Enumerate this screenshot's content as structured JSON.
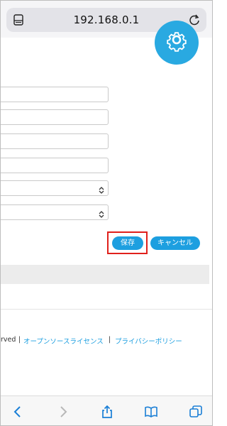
{
  "browser": {
    "url": "192.168.0.1",
    "menu_icon": "page-menu-icon",
    "reload_icon": "reload-icon"
  },
  "header": {
    "icon": "gear-icon",
    "accent_color": "#29a9e1"
  },
  "form": {
    "fields": [
      {
        "type": "text",
        "value": ""
      },
      {
        "type": "text",
        "value": ""
      },
      {
        "type": "text",
        "value": ""
      },
      {
        "type": "text",
        "value": ""
      },
      {
        "type": "select",
        "value": ""
      },
      {
        "type": "select",
        "value": ""
      }
    ]
  },
  "actions": {
    "save_label": "保存",
    "cancel_label": "キャンセル",
    "highlight_color": "#e0201b"
  },
  "footer": {
    "rights_fragment": "rved",
    "separator": "|",
    "open_source_label": "オープンソースライセンス",
    "privacy_label": "プライバシーポリシー"
  },
  "toolbar": {
    "items": [
      "back-icon",
      "forward-icon",
      "share-icon",
      "bookmarks-icon",
      "tabs-icon"
    ]
  }
}
